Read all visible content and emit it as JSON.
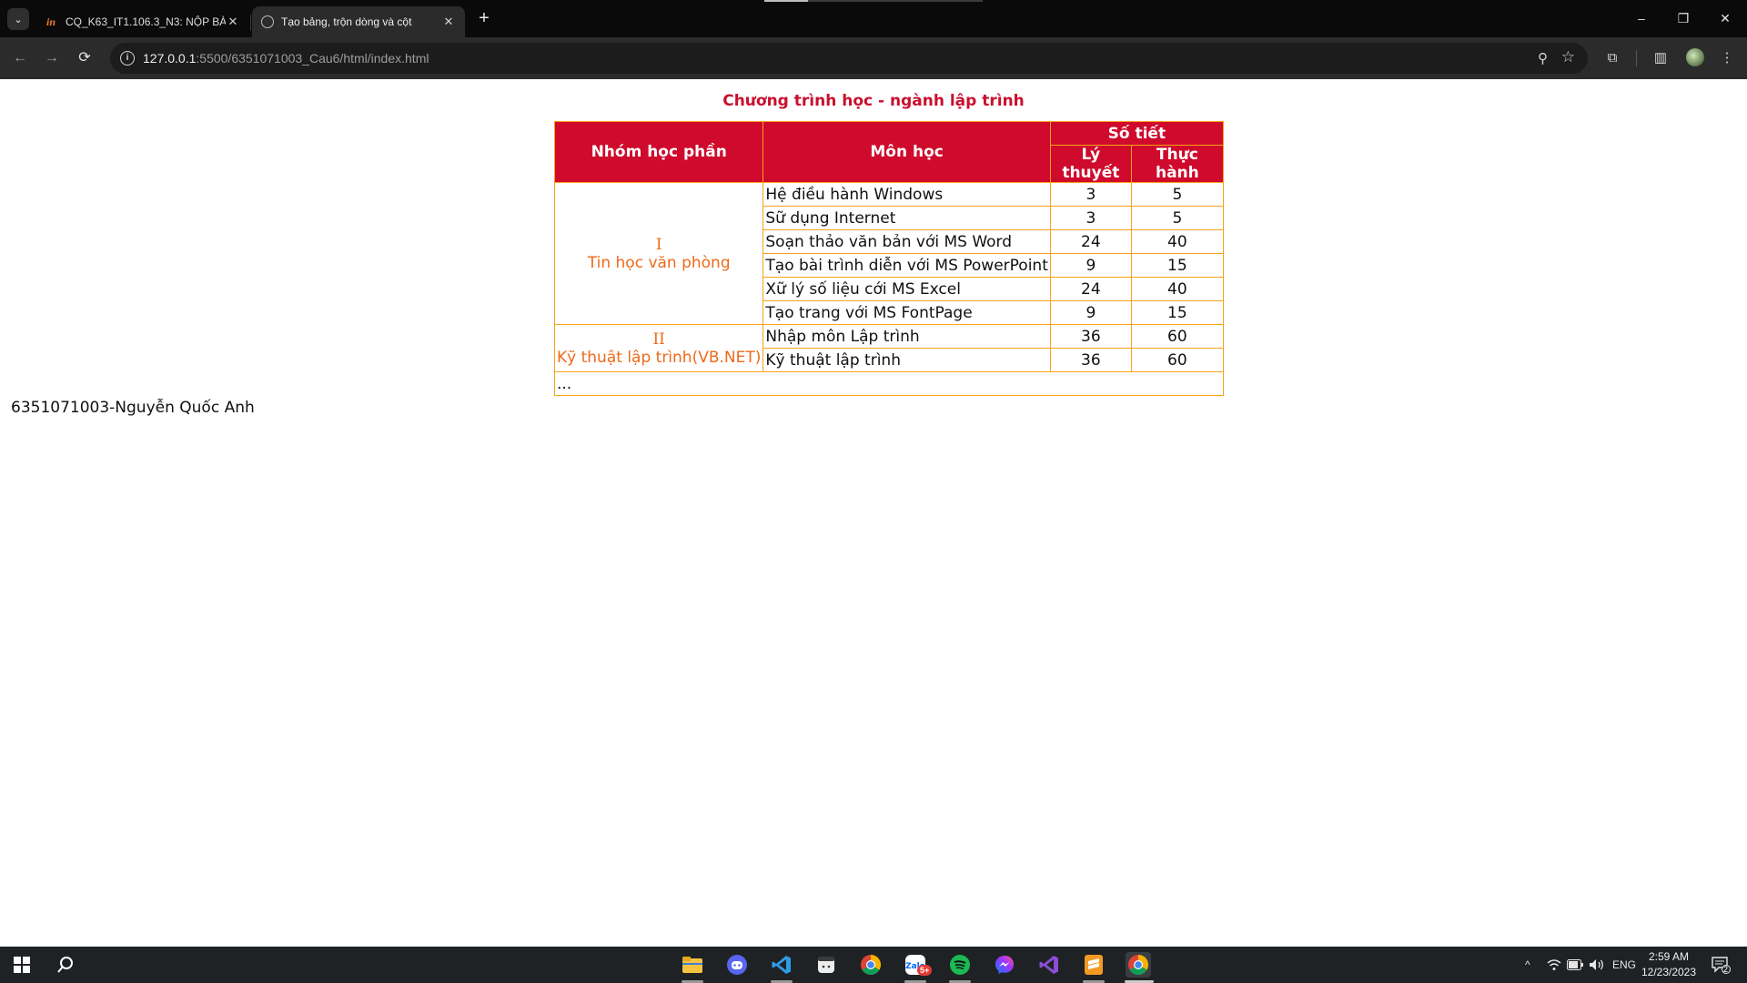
{
  "browser": {
    "tabs": [
      {
        "title": "CQ_K63_IT1.106.3_N3: NỘP BÀ",
        "favicon": "in-logo",
        "active": false
      },
      {
        "title": "Tạo bảng, trộn dòng và cột",
        "favicon": "globe-icon",
        "active": true
      }
    ],
    "url": {
      "host": "127.0.0.1",
      "rest": ":5500/6351071003_Cau6/html/index.html"
    },
    "icons": {
      "tab_search": "⌄",
      "new_tab": "+",
      "close": "✕",
      "minimize": "–",
      "restore": "❐",
      "close_window": "✕",
      "back": "←",
      "forward": "→",
      "reload": "⟳",
      "info": "i",
      "zoom": "⚲",
      "star": "☆",
      "extensions": "⧉",
      "sidepanel": "▥"
    }
  },
  "page": {
    "caption": "Chương trình học - ngành lập trình",
    "headers": {
      "group": "Nhóm học phần",
      "subject": "Môn học",
      "periods": "Số tiết",
      "theory": "Lý thuyết",
      "practice": "Thực hành"
    },
    "groups": [
      {
        "number": "I",
        "name": "Tin học văn phòng",
        "rows": [
          {
            "subject": "Hệ điều hành Windows",
            "theory": "3",
            "practice": "5"
          },
          {
            "subject": "Sữ dụng Internet",
            "theory": "3",
            "practice": "5"
          },
          {
            "subject": "Soạn thảo văn bản với MS Word",
            "theory": "24",
            "practice": "40"
          },
          {
            "subject": "Tạo bài trình diễn với MS PowerPoint",
            "theory": "9",
            "practice": "15"
          },
          {
            "subject": "Xữ lý số liệu cới MS Excel",
            "theory": "24",
            "practice": "40"
          },
          {
            "subject": "Tạo trang với MS FontPage",
            "theory": "9",
            "practice": "15"
          }
        ]
      },
      {
        "number": "II",
        "name": "Kỹ thuật lập trình(VB.NET)",
        "rows": [
          {
            "subject": "Nhập môn Lập trình",
            "theory": "36",
            "practice": "60"
          },
          {
            "subject": "Kỹ thuật lập trình",
            "theory": "36",
            "practice": "60"
          }
        ]
      }
    ],
    "ellipsis": "...",
    "signature": "6351071003-Nguyễn Quốc Anh"
  },
  "taskbar": {
    "apps": [
      "file-explorer",
      "discord",
      "vscode",
      "notes",
      "chrome",
      "zalo",
      "spotify",
      "messenger",
      "visual-studio",
      "sublime",
      "chrome-active"
    ],
    "badge": "5+",
    "language": "ENG",
    "time": "2:59 AM",
    "date": "12/23/2023",
    "notifications": "2"
  },
  "colors": {
    "header_red": "#cf0a2c",
    "border_orange": "#f7a21b",
    "group_text_orange": "#ee6a1a",
    "caption_red": "#c8102e"
  }
}
